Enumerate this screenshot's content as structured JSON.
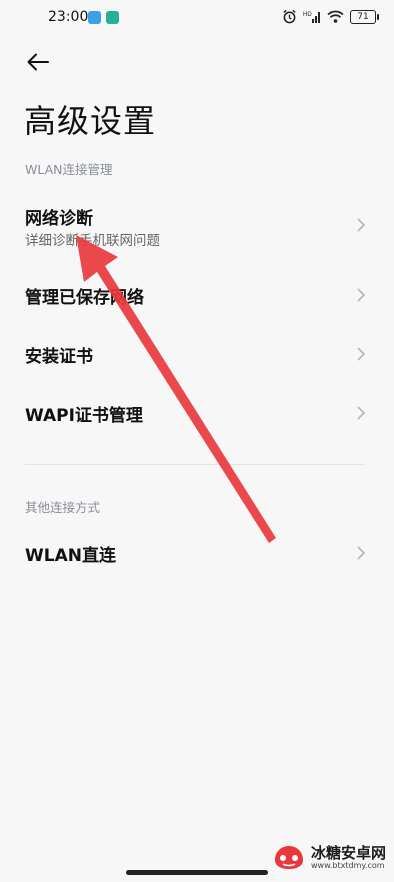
{
  "status_bar": {
    "time": "23:00",
    "battery": "71"
  },
  "page": {
    "title": "高级设置"
  },
  "sections": [
    {
      "label": "WLAN连接管理",
      "items": [
        {
          "title": "网络诊断",
          "subtitle": "详细诊断手机联网问题"
        },
        {
          "title": "管理已保存网络"
        },
        {
          "title": "安装证书"
        },
        {
          "title": "WAPI证书管理"
        }
      ]
    },
    {
      "label": "其他连接方式",
      "items": [
        {
          "title": "WLAN直连"
        }
      ]
    }
  ],
  "watermark": {
    "name": "冰糖安卓网",
    "url": "www.btxtdmy.com"
  },
  "colors": {
    "background": "#f7f7f7",
    "annotation_arrow": "#e8383d",
    "section_label": "#8a8f99"
  }
}
